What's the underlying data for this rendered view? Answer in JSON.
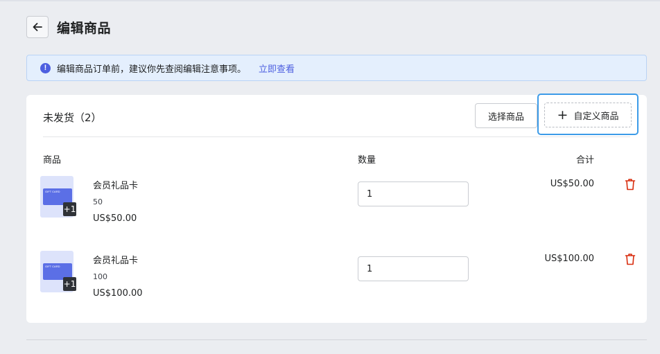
{
  "header": {
    "title": "编辑商品",
    "back_icon": "arrow-left-icon"
  },
  "banner": {
    "icon": "info-icon",
    "icon_glyph": "!",
    "text": "编辑商品订单前，建议你先查阅编辑注意事项。",
    "link": "立即查看",
    "link_color": "#4d5fe0"
  },
  "section": {
    "title": "未发货（2）",
    "select_button": "选择商品",
    "custom_button": "自定义商品",
    "custom_button_icon": "plus-icon",
    "columns": {
      "product": "商品",
      "quantity": "数量",
      "total": "合计"
    }
  },
  "items": [
    {
      "name": "会员礼品卡",
      "variant": "50",
      "price": "US$50.00",
      "quantity": "1",
      "total": "US$50.00",
      "badge": "+1",
      "thumb_label": "GIFT CARD"
    },
    {
      "name": "会员礼品卡",
      "variant": "100",
      "price": "US$100.00",
      "quantity": "1",
      "total": "US$100.00",
      "badge": "+1",
      "thumb_label": "GIFT CARD"
    }
  ],
  "colors": {
    "accent": "#4d5fe0",
    "focus_ring": "#3c9be8",
    "delete": "#d82c0d"
  }
}
